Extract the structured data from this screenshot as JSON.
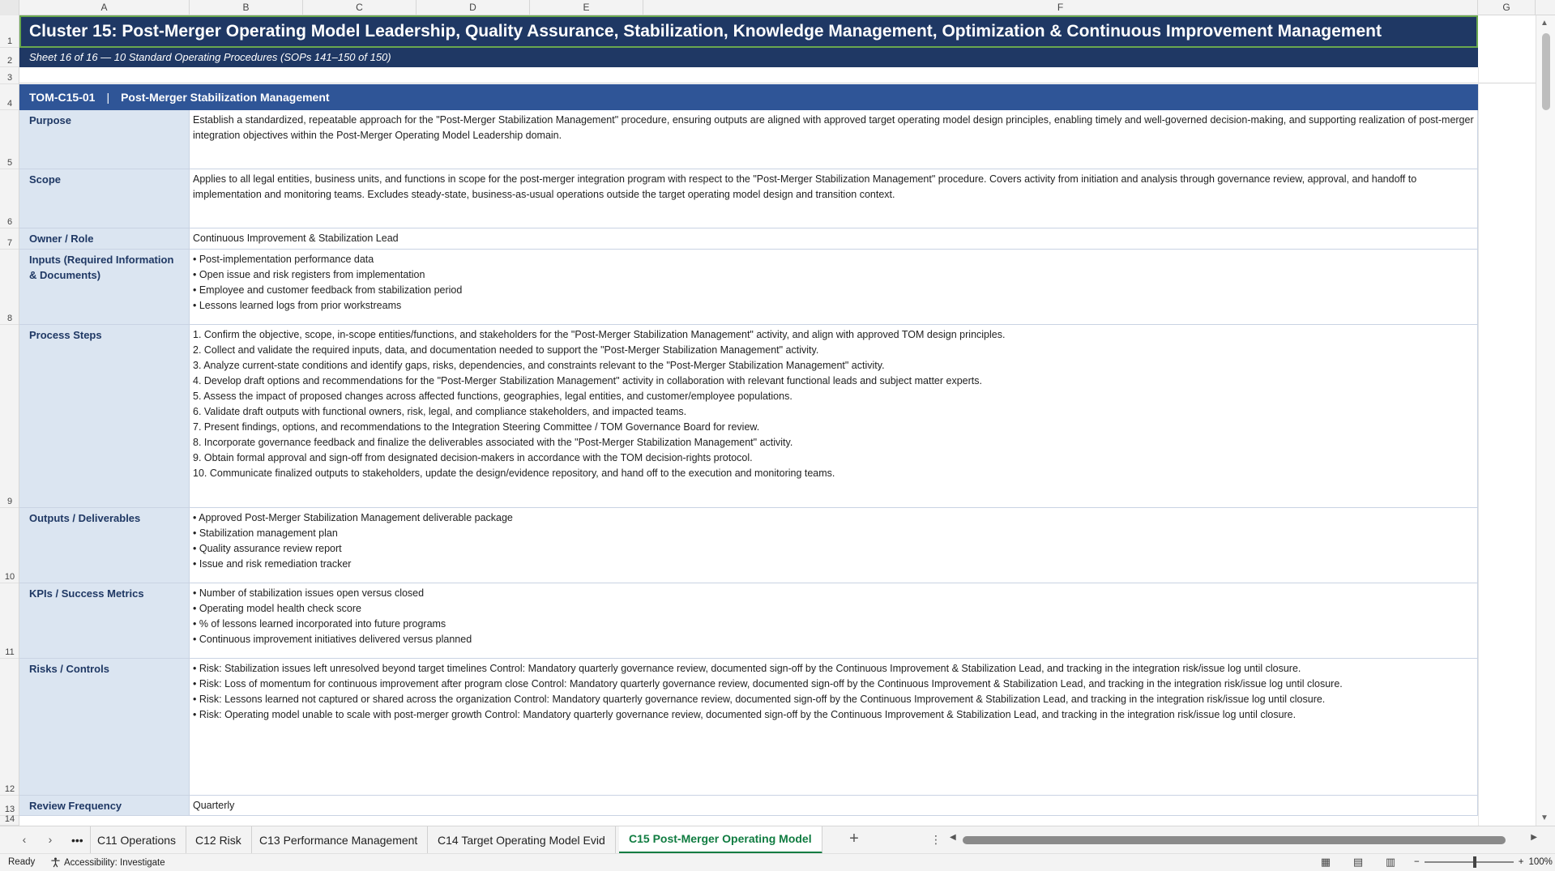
{
  "columns": [
    "A",
    "B",
    "C",
    "D",
    "E",
    "F",
    "G"
  ],
  "rows": [
    "1",
    "2",
    "3",
    "4",
    "5",
    "6",
    "7",
    "8",
    "9",
    "10",
    "11",
    "12",
    "13",
    "14"
  ],
  "title": "Cluster 15: Post-Merger Operating Model Leadership, Quality Assurance, Stabilization, Knowledge Management, Optimization & Continuous Improvement Management",
  "subtitle": "Sheet 16 of 16  —  10 Standard Operating Procedures (SOPs 141–150 of 150)",
  "sop": {
    "id": "TOM-C15-01",
    "separator": "|",
    "name": "Post-Merger Stabilization Management"
  },
  "fields": [
    {
      "label": "Purpose",
      "lines": [
        "Establish a standardized, repeatable approach for the \"Post-Merger Stabilization Management\" procedure, ensuring outputs are aligned with approved target operating model design principles, enabling timely and well-governed decision-making, and supporting realization of post-merger integration objectives within the Post-Merger Operating Model Leadership domain."
      ]
    },
    {
      "label": "Scope",
      "lines": [
        "Applies to all legal entities, business units, and functions in scope for the post-merger integration program with respect to the \"Post-Merger Stabilization Management\" procedure. Covers activity from initiation and analysis through governance review, approval, and handoff to implementation and monitoring teams. Excludes steady-state, business-as-usual operations outside the target operating model design and transition context."
      ]
    },
    {
      "label": "Owner / Role",
      "lines": [
        "Continuous Improvement & Stabilization Lead"
      ]
    },
    {
      "label": "Inputs (Required Information & Documents)",
      "lines": [
        "• Post-implementation performance data",
        "• Open issue and risk registers from implementation",
        "• Employee and customer feedback from stabilization period",
        "• Lessons learned logs from prior workstreams"
      ]
    },
    {
      "label": "Process Steps",
      "lines": [
        "1. Confirm the objective, scope, in-scope entities/functions, and stakeholders for the \"Post-Merger Stabilization Management\" activity, and align with approved TOM design principles.",
        "2. Collect and validate the required inputs, data, and documentation needed to support the \"Post-Merger Stabilization Management\" activity.",
        "3. Analyze current-state conditions and identify gaps, risks, dependencies, and constraints relevant to the \"Post-Merger Stabilization Management\" activity.",
        "4. Develop draft options and recommendations for the \"Post-Merger Stabilization Management\" activity in collaboration with relevant functional leads and subject matter experts.",
        "5. Assess the impact of proposed changes across affected functions, geographies, legal entities, and customer/employee populations.",
        "6. Validate draft outputs with functional owners, risk, legal, and compliance stakeholders, and impacted teams.",
        "7. Present findings, options, and recommendations to the Integration Steering Committee / TOM Governance Board for review.",
        "8. Incorporate governance feedback and finalize the deliverables associated with the \"Post-Merger Stabilization Management\" activity.",
        "9. Obtain formal approval and sign-off from designated decision-makers in accordance with the TOM decision-rights protocol.",
        "10. Communicate finalized outputs to stakeholders, update the design/evidence repository, and hand off to the execution and monitoring teams."
      ]
    },
    {
      "label": "Outputs / Deliverables",
      "lines": [
        "• Approved Post-Merger Stabilization Management deliverable package",
        "• Stabilization management plan",
        "• Quality assurance review report",
        "• Issue and risk remediation tracker"
      ]
    },
    {
      "label": "KPIs / Success Metrics",
      "lines": [
        "• Number of stabilization issues open versus closed",
        "• Operating model health check score",
        "• % of lessons learned incorporated into future programs",
        "• Continuous improvement initiatives delivered versus planned"
      ]
    },
    {
      "label": "Risks / Controls",
      "lines": [
        "• Risk: Stabilization issues left unresolved beyond target timelines Control: Mandatory quarterly governance review, documented sign-off by the Continuous Improvement & Stabilization Lead, and tracking in the integration risk/issue log until closure.",
        "• Risk: Loss of momentum for continuous improvement after program close Control: Mandatory quarterly governance review, documented sign-off by the Continuous Improvement & Stabilization Lead, and tracking in the integration risk/issue log until closure.",
        "• Risk: Lessons learned not captured or shared across the organization Control: Mandatory quarterly governance review, documented sign-off by the Continuous Improvement & Stabilization Lead, and tracking in the integration risk/issue log until closure.",
        "• Risk: Operating model unable to scale with post-merger growth Control: Mandatory quarterly governance review, documented sign-off by the Continuous Improvement & Stabilization Lead, and tracking in the integration risk/issue log until closure."
      ]
    },
    {
      "label": "Review Frequency",
      "lines": [
        "Quarterly"
      ]
    }
  ],
  "tabs": {
    "overflow": "•••",
    "items": [
      "C11 Operations",
      "C12 Risk",
      "C13 Performance Management",
      "C14 Target Operating Model Evid",
      "C15 Post-Merger Operating Model"
    ],
    "active_index": 4,
    "add": "+",
    "menu": "⋮"
  },
  "status": {
    "ready": "Ready",
    "accessibility": "Accessibility: Investigate",
    "zoom_minus": "−",
    "zoom_plus": "+",
    "zoom": "100%"
  }
}
